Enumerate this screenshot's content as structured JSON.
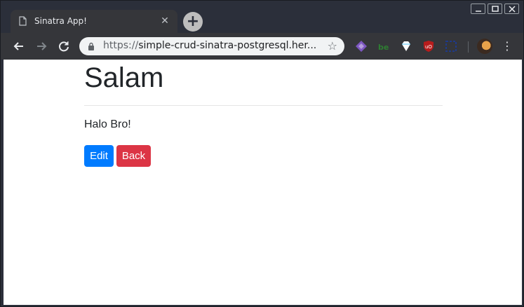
{
  "browser": {
    "tab": {
      "title": "Sinatra App!",
      "close_glyph": "✕"
    },
    "new_tab_glyph": "+",
    "address": {
      "scheme": "https://",
      "rest": "simple-crud-sinatra-postgresql.her..."
    },
    "star_glyph": "☆",
    "menu_glyph": "⋮",
    "extensions": [
      "purple-extension-icon",
      "green-extension-icon",
      "diamond-extension-icon",
      "ublock-icon",
      "blue-extension-icon"
    ]
  },
  "page": {
    "heading": "Salam",
    "content": "Halo Bro!",
    "buttons": {
      "edit": "Edit",
      "back": "Back"
    }
  },
  "colors": {
    "primary": "#007bff",
    "danger": "#dc3545",
    "chrome_dark": "#2b2f3a"
  }
}
